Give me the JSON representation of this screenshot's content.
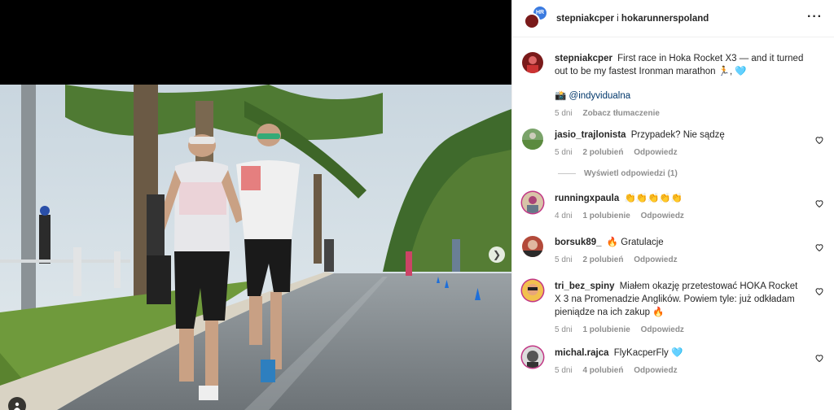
{
  "header": {
    "user1": "stepniakcper",
    "separator": "i",
    "user2": "hokarunnerspoland",
    "badge": "HR"
  },
  "caption": {
    "username": "stepniakcper",
    "text": "First race in Hoka Rocket X3 — and it turned out to be my fastest Ironman marathon 🏃, 🩵",
    "credit_icon": "📸",
    "credit": "@indyvidualna",
    "age": "5 dni",
    "translate": "Zobacz tłumaczenie"
  },
  "comments": [
    {
      "username": "jasio_trajlonista",
      "text": "Przypadek? Nie sądzę",
      "age": "5 dni",
      "likes": "2 polubień",
      "reply": "Odpowiedz"
    },
    {
      "username": "runningxpaula",
      "text": "👏👏👏👏👏",
      "age": "4 dni",
      "likes": "1 polubienie",
      "reply": "Odpowiedz"
    },
    {
      "username": "borsuk89_",
      "text": "🔥 Gratulacje",
      "age": "5 dni",
      "likes": "2 polubień",
      "reply": "Odpowiedz"
    },
    {
      "username": "tri_bez_spiny",
      "text": "Miałem okazję przetestować HOKA Rocket X 3 na Promenadzie Anglików. Powiem tyle: już odkładam pieniądze na ich zakup 🔥",
      "age": "5 dni",
      "likes": "1 polubienie",
      "reply": "Odpowiedz"
    },
    {
      "username": "michal.rajca",
      "text": "FlyKacperFly 🩵",
      "age": "5 dni",
      "likes": "4 polubień",
      "reply": "Odpowiedz"
    }
  ],
  "view_replies": "Wyświetl odpowiedzi (1)",
  "icons": {
    "more": "more-options-icon",
    "heart": "heart-icon",
    "next": "chevron-right-icon",
    "tag": "user-tag-icon"
  }
}
